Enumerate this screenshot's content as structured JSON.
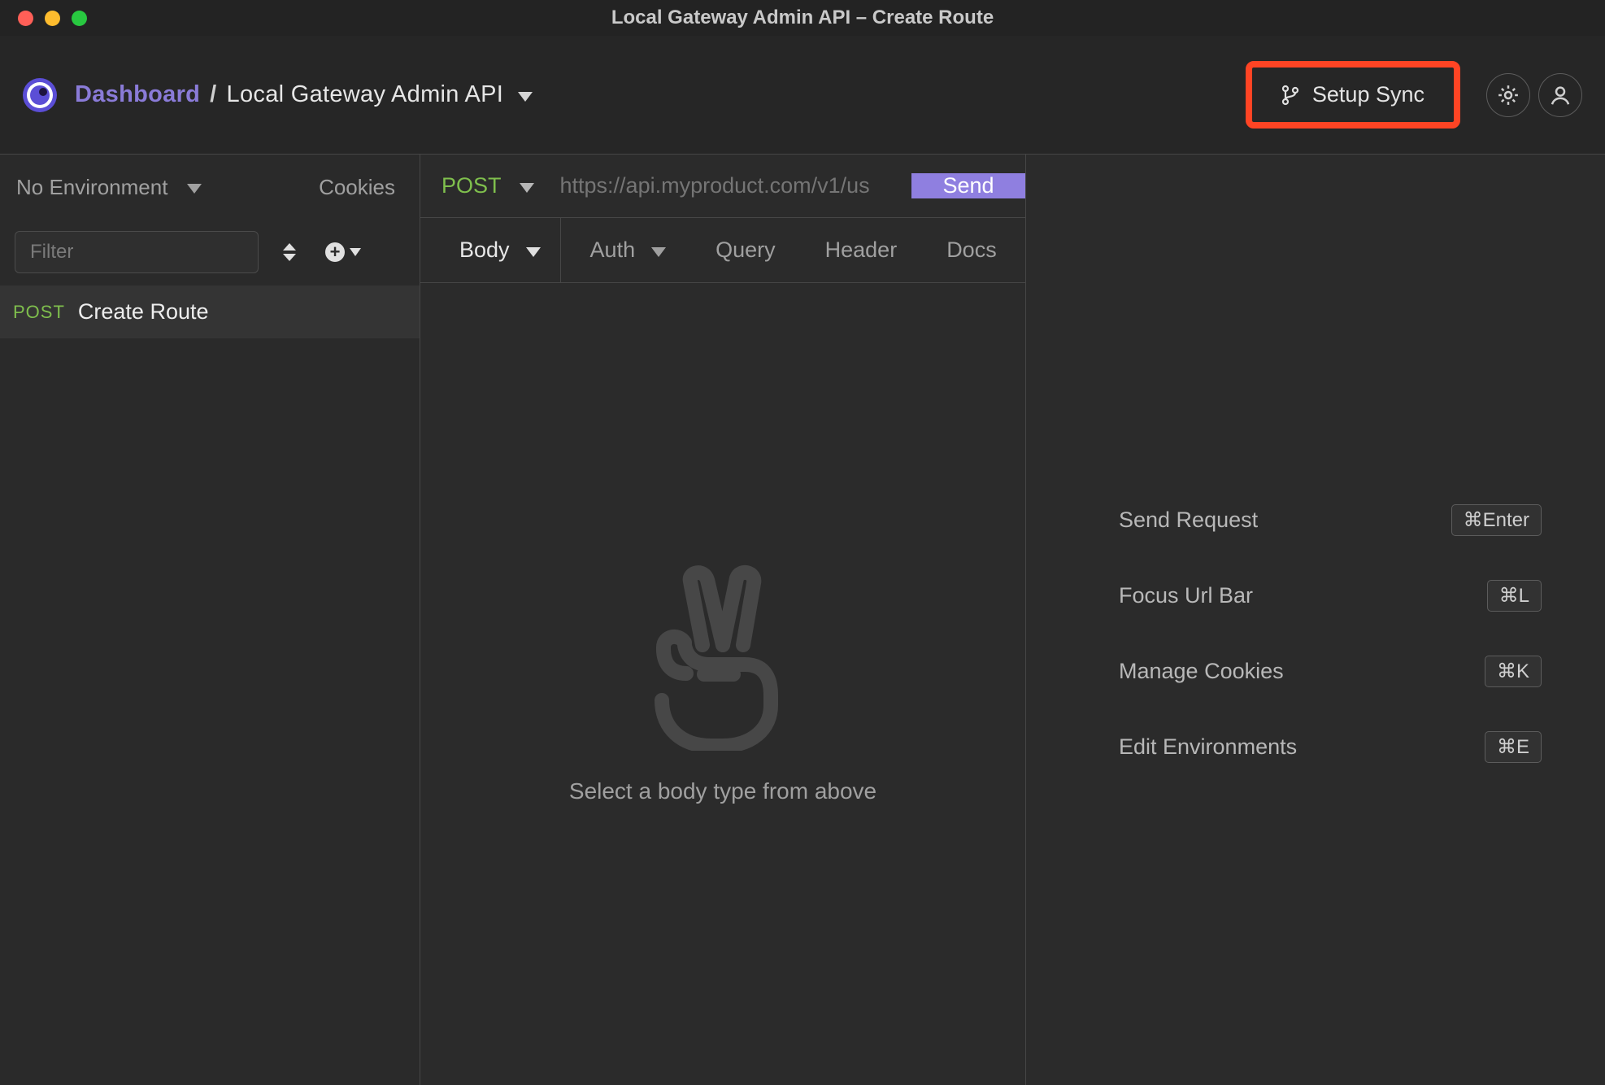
{
  "titlebar": {
    "title": "Local Gateway Admin API – Create Route"
  },
  "header": {
    "dashboard_label": "Dashboard",
    "separator": "/",
    "workspace": "Local Gateway Admin API",
    "setup_sync_label": "Setup Sync"
  },
  "sidebar": {
    "env_label": "No Environment",
    "cookies_label": "Cookies",
    "filter_placeholder": "Filter",
    "requests": [
      {
        "method": "POST",
        "name": "Create Route"
      }
    ]
  },
  "request": {
    "method": "POST",
    "url_placeholder": "https://api.myproduct.com/v1/us",
    "send_label": "Send",
    "tabs": {
      "body": "Body",
      "auth": "Auth",
      "query": "Query",
      "header": "Header",
      "docs": "Docs"
    },
    "body_empty_hint": "Select a body type from above"
  },
  "shortcuts": [
    {
      "label": "Send Request",
      "key": "⌘Enter"
    },
    {
      "label": "Focus Url Bar",
      "key": "⌘L"
    },
    {
      "label": "Manage Cookies",
      "key": "⌘K"
    },
    {
      "label": "Edit Environments",
      "key": "⌘E"
    }
  ]
}
